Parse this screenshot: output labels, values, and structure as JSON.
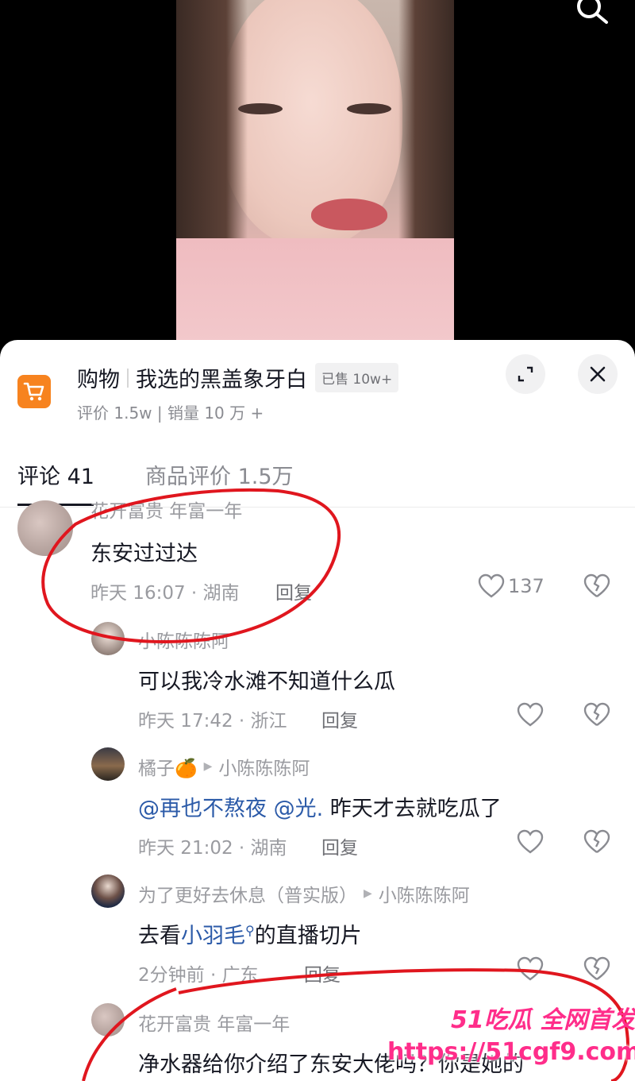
{
  "shop": {
    "category": "购物",
    "product_name": "我选的黑盖象牙白",
    "sold_badge": "已售 10w+",
    "subtitle": "评价 1.5w | 销量 10 万 +"
  },
  "tabs": [
    {
      "label": "评论 41",
      "active": true
    },
    {
      "label": "商品评价 1.5万",
      "active": false
    }
  ],
  "comments": [
    {
      "name": "花开富贵 年富一年",
      "text": "东安过过达",
      "time_location": "昨天 16:07 · 湖南",
      "reply": "回复",
      "likes": "137"
    },
    {
      "name": "小陈陈陈阿",
      "text": "可以我冷水滩不知道什么瓜",
      "time_location": "昨天 17:42 · 浙江",
      "reply": "回复"
    },
    {
      "name": "橘子🍊",
      "reply_to": "小陈陈陈阿",
      "mention1": "@再也不熬夜",
      "mention2": "@光.",
      "text_after": "昨天才去就吃瓜了",
      "time_location": "昨天 21:02 · 湖南",
      "reply": "回复"
    },
    {
      "name": "为了更好去休息（普实版）",
      "reply_to": "小陈陈陈阿",
      "text_before": "去看",
      "link_text": "小羽毛",
      "text_after": "的直播切片",
      "time_location": "2分钟前 · 广东",
      "reply": "回复"
    },
    {
      "name": "花开富贵 年富一年",
      "text": "净水器给你介绍了东安大佬吗？你是她的"
    }
  ],
  "watermark": {
    "line1": "51吃瓜 全网首发",
    "line2": "https://51cgf9.com"
  },
  "colors": {
    "accent_orange": "#f7831f",
    "mention_blue": "#2b5aa8",
    "annotation_red": "#e0161e",
    "watermark_pink": "#ff2d8a"
  }
}
